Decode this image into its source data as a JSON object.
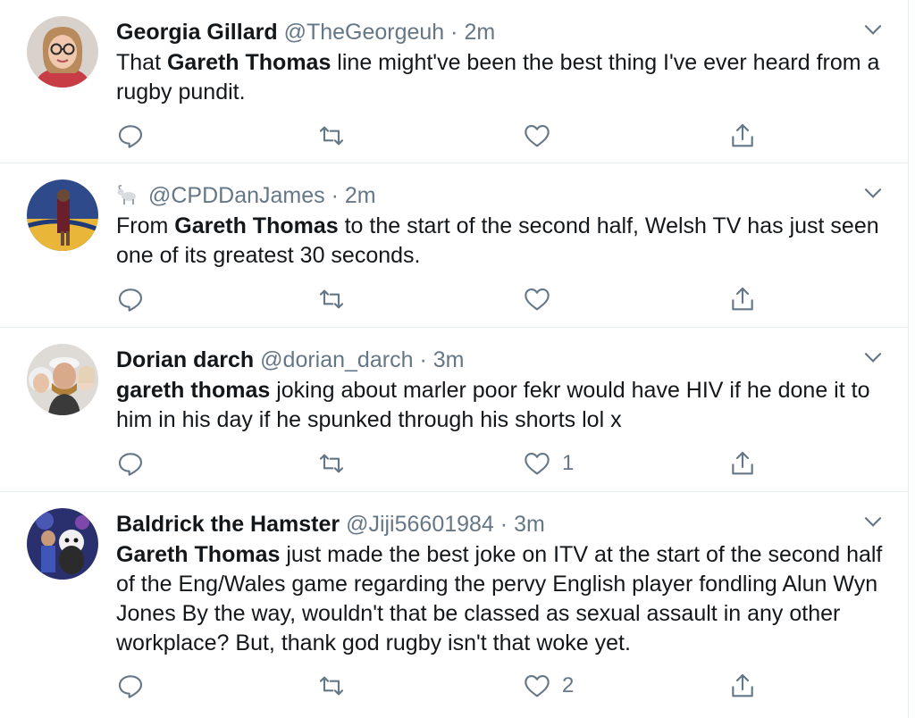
{
  "tweets": [
    {
      "name": "Georgia Gillard",
      "handle": "@TheGeorgeuh",
      "separator": "·",
      "time": "2m",
      "text_bold": "Gareth Thomas",
      "text_pre": "That ",
      "text_post": " line might've been the best thing I've ever heard from a rugby pundit.",
      "likes": "",
      "avatar_icon": "woman-glasses-avatar"
    },
    {
      "name": "",
      "handle": "@CPDDanJames",
      "separator": "·",
      "time": "2m",
      "name_icon": "goat-emoji",
      "text_pre": "From ",
      "text_bold": "Gareth Thomas",
      "text_post": " to the start of the second half, Welsh TV has just seen one of its greatest 30 seconds.",
      "likes": "",
      "avatar_icon": "basketball-player-avatar"
    },
    {
      "name": "Dorian darch",
      "handle": "@dorian_darch",
      "separator": "·",
      "time": "3m",
      "text_pre": "",
      "text_bold": "gareth thomas",
      "text_post": " joking about marler poor fekr would have HIV if he done it to him in his day if he spunked through his shorts lol x",
      "likes": "1",
      "avatar_icon": "group-selfie-avatar"
    },
    {
      "name": "Baldrick the Hamster",
      "handle": "@Jiji56601984",
      "separator": "·",
      "time": "3m",
      "text_pre": "",
      "text_bold": "Gareth Thomas",
      "text_post": " just made the best joke on ITV at the start of the second half of the Eng/Wales game regarding the pervy English player fondling Alun Wyn Jones By the way, wouldn't that be classed as sexual assault in any other workplace? But, thank god rugby isn't that woke yet.",
      "likes": "2",
      "avatar_icon": "mascot-avatar"
    }
  ],
  "colors": {
    "text": "#14171a",
    "muted": "#657786",
    "border": "#e6ecf0"
  }
}
